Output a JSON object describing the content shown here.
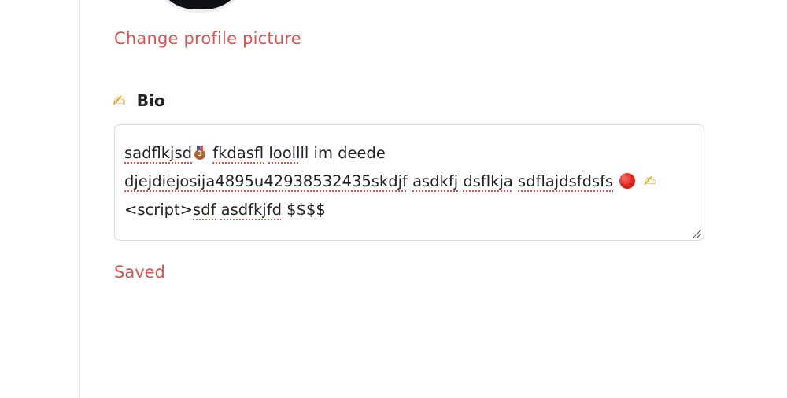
{
  "profile": {
    "change_picture_label": "Change profile picture"
  },
  "bio": {
    "label_icon": "writing-hand-icon",
    "label": "Bio",
    "line1_a": "sadflkjsd",
    "line1_b": "fkdasfl",
    "line1_c": "looll",
    "line1_d": "ll im deede",
    "line2_a": "djejdiejosija4895u42938532435skdjf",
    "line2_b": "asdkfj",
    "line2_c": "dsflkja",
    "line2_d": "sdflajdsfdsfs",
    "line3_a": "<script>",
    "line3_b": "sdf",
    "line3_c": "asdfkjfd",
    "line3_d": "$$$$",
    "emojis": [
      "bronze-medal-icon",
      "red-circle-icon",
      "writing-hand-icon"
    ]
  },
  "status": {
    "text": "Saved"
  },
  "colors": {
    "accent": "#d9534f",
    "text": "#222222",
    "border": "#d9d9d9",
    "divider": "#e6e6e6"
  }
}
